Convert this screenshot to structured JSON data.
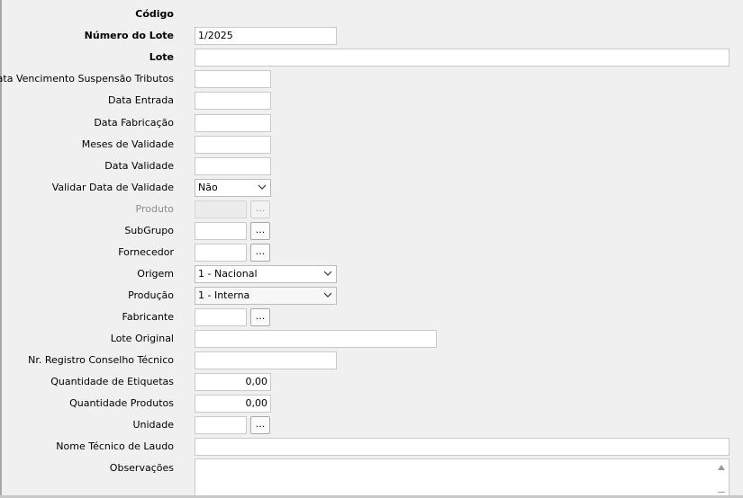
{
  "form": {
    "codigo": {
      "label": "Código"
    },
    "numero_lote": {
      "label": "Número do Lote",
      "value": "1/2025"
    },
    "lote": {
      "label": "Lote",
      "value": ""
    },
    "data_venc_suspensao": {
      "label": "Data Vencimento Suspensão Tributos",
      "value": ""
    },
    "data_entrada": {
      "label": "Data Entrada",
      "value": ""
    },
    "data_fabricacao": {
      "label": "Data Fabricação",
      "value": ""
    },
    "meses_validade": {
      "label": "Meses de Validade",
      "value": ""
    },
    "data_validade": {
      "label": "Data Validade",
      "value": ""
    },
    "validar_data_validade": {
      "label": "Validar Data de Validade",
      "value": "Não"
    },
    "produto": {
      "label": "Produto",
      "value": "",
      "button": "..."
    },
    "subgrupo": {
      "label": "SubGrupo",
      "value": "",
      "button": "..."
    },
    "fornecedor": {
      "label": "Fornecedor",
      "value": "",
      "button": "..."
    },
    "origem": {
      "label": "Origem",
      "value": "1 - Nacional"
    },
    "producao": {
      "label": "Produção",
      "value": "1 - Interna"
    },
    "fabricante": {
      "label": "Fabricante",
      "value": "",
      "button": "..."
    },
    "lote_original": {
      "label": "Lote Original",
      "value": ""
    },
    "nr_registro": {
      "label": "Nr. Registro Conselho Técnico",
      "value": ""
    },
    "qtd_etiquetas": {
      "label": "Quantidade de Etiquetas",
      "value": "0,00"
    },
    "qtd_produtos": {
      "label": "Quantidade Produtos",
      "value": "0,00"
    },
    "unidade": {
      "label": "Unidade",
      "value": "",
      "button": "..."
    },
    "nome_tecnico_laudo": {
      "label": "Nome Técnico de Laudo",
      "value": ""
    },
    "observacoes": {
      "label": "Observações",
      "value": ""
    }
  },
  "icons": {
    "dropdown": "chevron-down-icon",
    "scroll_up": "scroll-up-arrow-icon"
  },
  "colors": {
    "background": "#f0f0f0",
    "input_background": "#ffffff",
    "input_border": "#c9c9c9",
    "disabled_label": "#8c8c8c"
  }
}
